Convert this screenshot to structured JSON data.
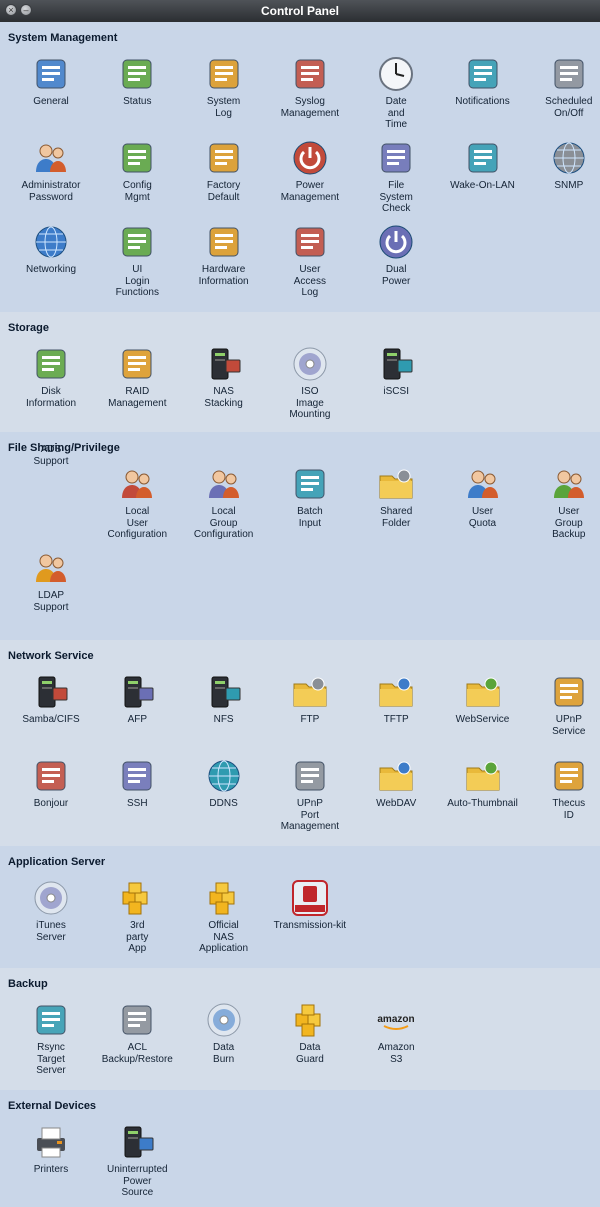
{
  "window": {
    "title": "Control Panel"
  },
  "sections": [
    {
      "title": "System Management",
      "items": [
        {
          "label": "General",
          "icon": "monitor-magnifier-icon"
        },
        {
          "label": "Status",
          "icon": "status-gauge-icon"
        },
        {
          "label": "System\nLog",
          "icon": "clipboard-log-icon"
        },
        {
          "label": "Syslog\nManagement",
          "icon": "syslog-tools-icon"
        },
        {
          "label": "Date\nand\nTime",
          "icon": "clock-icon"
        },
        {
          "label": "Notifications",
          "icon": "notification-alert-icon"
        },
        {
          "label": "Scheduled\nOn/Off",
          "icon": "calendar-schedule-icon"
        },
        {
          "label": "Administrator\nPassword",
          "icon": "admin-user-icon"
        },
        {
          "label": "Config\nMgmt",
          "icon": "config-upload-icon"
        },
        {
          "label": "Factory\nDefault",
          "icon": "green-arrows-reset-icon"
        },
        {
          "label": "Power\nManagement",
          "icon": "power-button-icon"
        },
        {
          "label": "File\nSystem\nCheck",
          "icon": "stethoscope-disk-icon"
        },
        {
          "label": "Wake-On-LAN",
          "icon": "wake-on-lan-icon"
        },
        {
          "label": "SNMP",
          "icon": "snmp-network-icon"
        },
        {
          "label": "Networking",
          "icon": "network-globe-icon"
        },
        {
          "label": "UI\nLogin\nFunctions",
          "icon": "ui-login-icon"
        },
        {
          "label": "Hardware\nInformation",
          "icon": "circuit-board-icon"
        },
        {
          "label": "User\nAccess\nLog",
          "icon": "clipboard-access-log-icon"
        },
        {
          "label": "Dual\nPower",
          "icon": "dual-power-icon"
        }
      ]
    },
    {
      "title": "Storage",
      "items": [
        {
          "label": "Disk\nInformation",
          "icon": "disk-sheets-icon"
        },
        {
          "label": "RAID\nManagement",
          "icon": "raid-database-icon"
        },
        {
          "label": "NAS\nStacking",
          "icon": "nas-stack-icon"
        },
        {
          "label": "ISO\nImage\nMounting",
          "icon": "iso-disc-icon"
        },
        {
          "label": "iSCSI",
          "icon": "iscsi-server-icon"
        }
      ]
    },
    {
      "title": "File Sharing/Privilege",
      "items": [
        {
          "label": "ADS\nSupport",
          "icon": ""
        },
        {
          "label": "Local\nUser\nConfiguration",
          "icon": "local-users-icon"
        },
        {
          "label": "Local\nGroup\nConfiguration",
          "icon": "local-group-icon"
        },
        {
          "label": "Batch\nInput",
          "icon": "batch-input-icon"
        },
        {
          "label": "Shared\nFolder",
          "icon": "shared-folder-icon"
        },
        {
          "label": "User\nQuota",
          "icon": "user-quota-icon"
        },
        {
          "label": "User\nGroup\nBackup",
          "icon": "user-group-backup-icon"
        },
        {
          "label": "LDAP\nSupport",
          "icon": "ldap-users-icon"
        }
      ]
    },
    {
      "title": "Network Service",
      "items": [
        {
          "label": "Samba/CIFS",
          "icon": "samba-server-icon"
        },
        {
          "label": "AFP",
          "icon": "afp-server-icon"
        },
        {
          "label": "NFS",
          "icon": "nfs-server-icon"
        },
        {
          "label": "FTP",
          "icon": "ftp-folder-icon"
        },
        {
          "label": "TFTP",
          "icon": "tftp-folder-icon"
        },
        {
          "label": "WebService",
          "icon": "webservice-folder-icon"
        },
        {
          "label": "UPnP\nService",
          "icon": "upnp-cloud-icon"
        },
        {
          "label": "Bonjour",
          "icon": "bonjour-icon"
        },
        {
          "label": "SSH",
          "icon": "ssh-lock-icon"
        },
        {
          "label": "DDNS",
          "icon": "ddns-globe-icon"
        },
        {
          "label": "UPnP\nPort\nManagement",
          "icon": "upnp-port-icon"
        },
        {
          "label": "WebDAV",
          "icon": "webdav-folder-icon"
        },
        {
          "label": "Auto-Thumbnail",
          "icon": "thumbnail-folder-icon"
        },
        {
          "label": "Thecus\nID",
          "icon": "thecus-id-card-icon"
        }
      ]
    },
    {
      "title": "Application Server",
      "items": [
        {
          "label": "iTunes\nServer",
          "icon": "itunes-disc-icon"
        },
        {
          "label": "3rd\nparty\nApp",
          "icon": "blocks-icon"
        },
        {
          "label": "Official\nNAS\nApplication",
          "icon": "nas-app-blocks-icon"
        },
        {
          "label": "Transmission-kit",
          "icon": "transmission-icon"
        }
      ]
    },
    {
      "title": "Backup",
      "items": [
        {
          "label": "Rsync\nTarget\nServer",
          "icon": "rsync-icon"
        },
        {
          "label": "ACL\nBackup/Restore",
          "icon": "acl-backup-icon"
        },
        {
          "label": "Data\nBurn",
          "icon": "data-burn-disc-icon"
        },
        {
          "label": "Data\nGuard",
          "icon": "data-guard-box-icon"
        },
        {
          "label": "Amazon\nS3",
          "icon": "amazon-s3-logo-icon"
        }
      ]
    },
    {
      "title": "External Devices",
      "items": [
        {
          "label": "Printers",
          "icon": "printer-icon"
        },
        {
          "label": "Uninterrupted\nPower\nSource",
          "icon": "ups-icon"
        }
      ]
    }
  ]
}
